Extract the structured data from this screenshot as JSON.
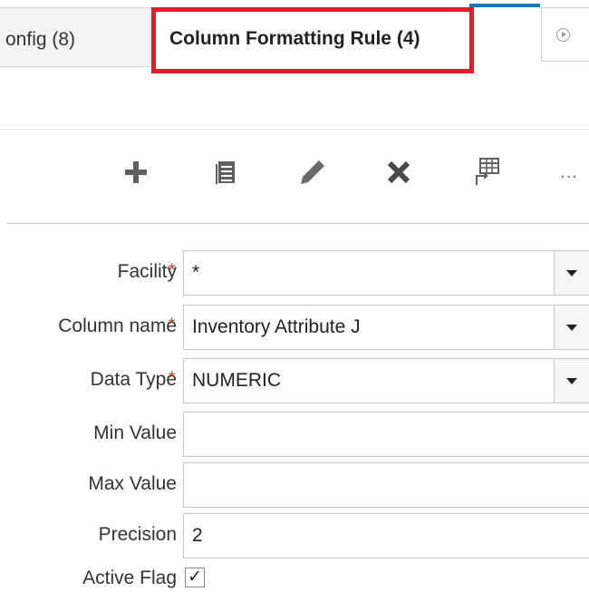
{
  "tabs": {
    "previous_label": "onfig (8)",
    "active_label": "Column Formatting Rule (4)"
  },
  "toolbar": {
    "add_icon": "plus-icon",
    "copy_icon": "document-icon",
    "edit_icon": "pencil-icon",
    "delete_icon": "close-icon",
    "export_icon": "grid-export-icon",
    "more_label": "..."
  },
  "form": {
    "required_marker": "*",
    "facility": {
      "label": "Facility",
      "value": "*"
    },
    "column_name": {
      "label": "Column name",
      "value": "Inventory Attribute J"
    },
    "data_type": {
      "label": "Data Type",
      "value": "NUMERIC"
    },
    "min_value": {
      "label": "Min Value",
      "value": ""
    },
    "max_value": {
      "label": "Max Value",
      "value": ""
    },
    "precision": {
      "label": "Precision",
      "value": "2"
    },
    "active_flag": {
      "label": "Active Flag",
      "checked": true,
      "check_glyph": "✓"
    }
  },
  "colors": {
    "highlight_box": "#e01e2b",
    "required_star": "#c0392b",
    "tab_accent": "#1b75bb"
  }
}
